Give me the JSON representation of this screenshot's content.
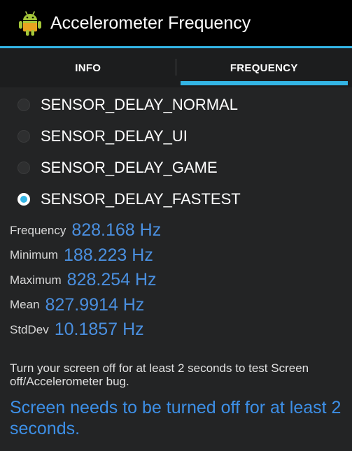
{
  "app": {
    "title": "Accelerometer Frequency",
    "icon": "android-robot-icon"
  },
  "tabs": [
    {
      "label": "INFO",
      "selected": false
    },
    {
      "label": "FREQUENCY",
      "selected": true
    }
  ],
  "sensor_delay": {
    "options": [
      {
        "label": "SENSOR_DELAY_NORMAL",
        "checked": false
      },
      {
        "label": "SENSOR_DELAY_UI",
        "checked": false
      },
      {
        "label": "SENSOR_DELAY_GAME",
        "checked": false
      },
      {
        "label": "SENSOR_DELAY_FASTEST",
        "checked": true
      }
    ]
  },
  "stats": {
    "frequency": {
      "label": "Frequency",
      "value": "828.168 Hz"
    },
    "minimum": {
      "label": "Minimum",
      "value": "188.223 Hz"
    },
    "maximum": {
      "label": "Maximum",
      "value": "828.254 Hz"
    },
    "mean": {
      "label": "Mean",
      "value": "827.9914 Hz"
    },
    "stddev": {
      "label": "StdDev",
      "value": "10.1857 Hz"
    }
  },
  "messages": {
    "hint": "Turn your screen off for at least 2 seconds to test Screen off/Accelerometer bug.",
    "status": "Screen needs to be turned off for at least 2 seconds."
  },
  "colors": {
    "accent": "#33b5e5",
    "value_text": "#4a8fdf",
    "background": "#232425",
    "action_bar": "#000000"
  }
}
